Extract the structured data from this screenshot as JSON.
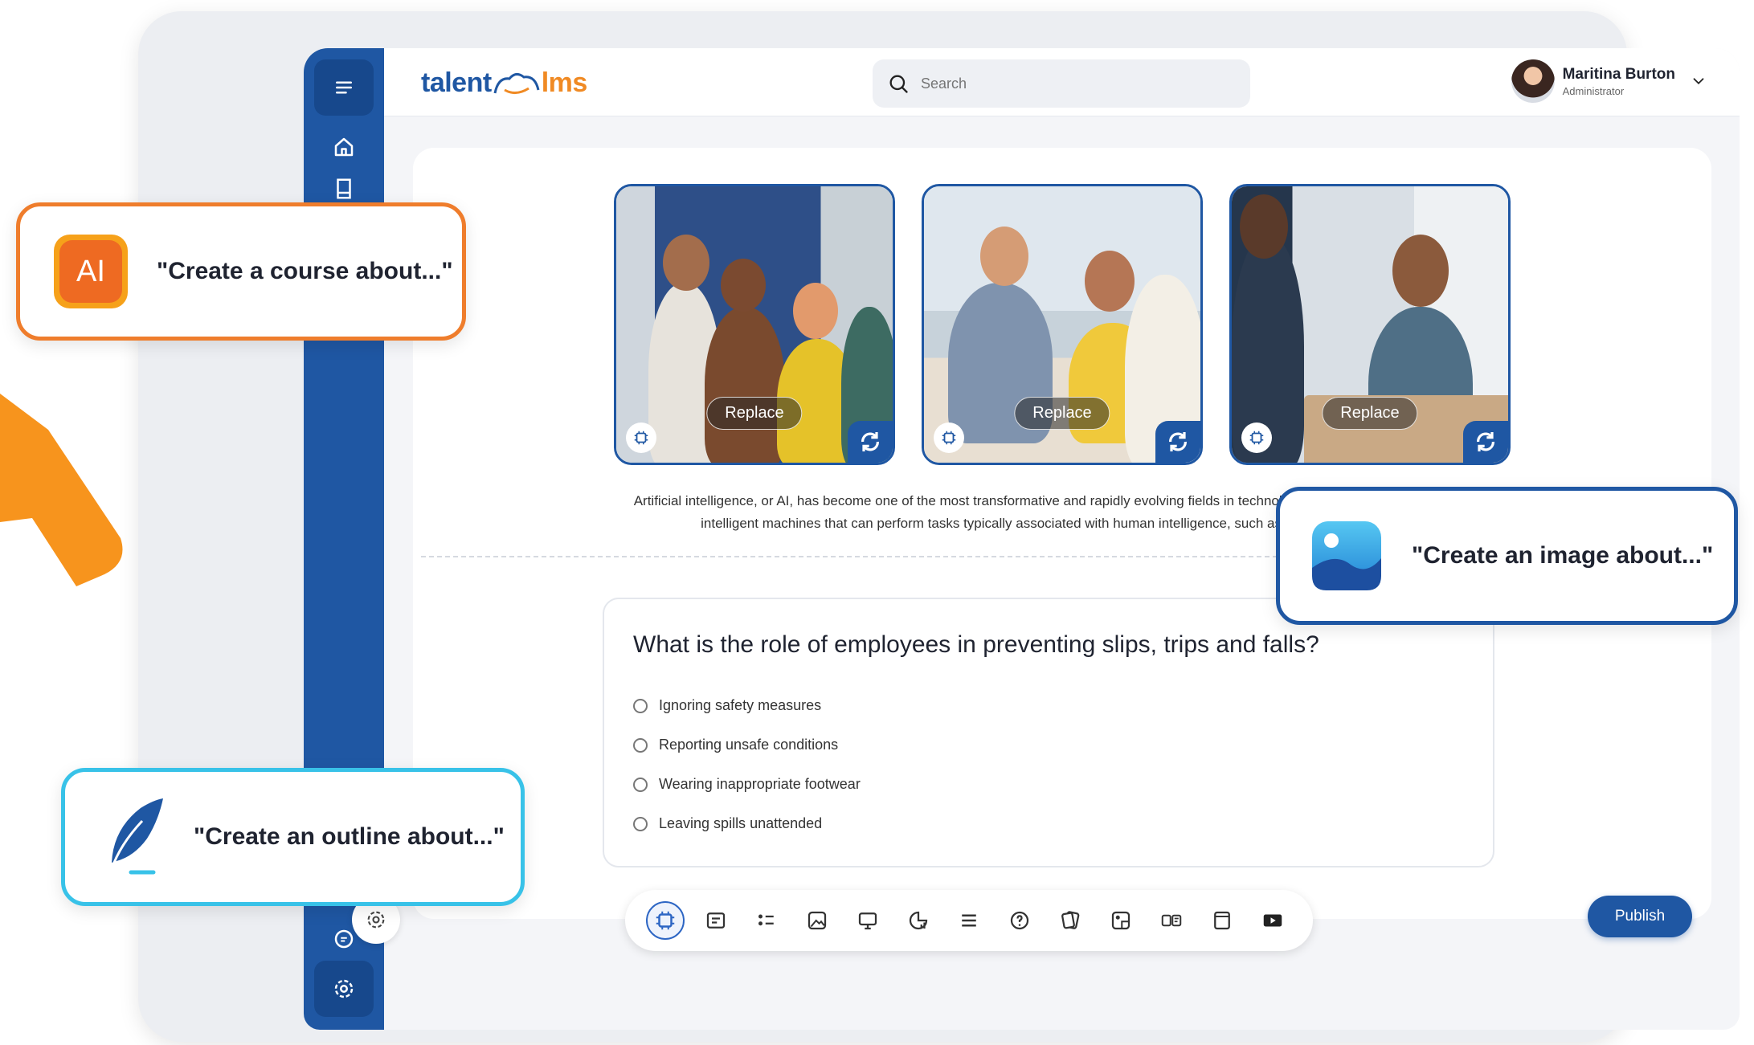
{
  "app": {
    "logo_left": "talent",
    "logo_right": "lms",
    "search_placeholder": "Search"
  },
  "user": {
    "name": "Maritina Burton",
    "role": "Administrator"
  },
  "sidebar": {
    "items": [
      "menu-icon",
      "home-icon",
      "book-icon",
      "chat-icon",
      "settings-icon"
    ]
  },
  "photos": [
    {
      "replace_label": "Replace"
    },
    {
      "replace_label": "Replace"
    },
    {
      "replace_label": "Replace"
    }
  ],
  "body_text": "Artificial intelligence, or AI, has become one of the most transformative and rapidly evolving fields in technology. It involves the creation of intelligent machines that can perform tasks typically associated with human intelligence, such as learning and probl",
  "quiz": {
    "question": "What is the role of employees in preventing slips, trips and falls?",
    "options": [
      "Ignoring safety measures",
      "Reporting unsafe conditions",
      "Wearing inappropriate footwear",
      "Leaving spills unattended"
    ]
  },
  "toolbar": {
    "tools": [
      "ai-chip-icon",
      "text-block-icon",
      "list-icon",
      "image-icon",
      "video-icon",
      "chart-icon",
      "lines-icon",
      "question-icon",
      "cards-icon",
      "gallery-icon",
      "toggle-icon",
      "page-icon",
      "embed-icon"
    ],
    "publish_label": "Publish"
  },
  "callouts": {
    "course": "\"Create a course about...\"",
    "image": "\"Create an image about...\"",
    "outline": "\"Create an outline about...\"",
    "ai_badge": "AI"
  },
  "colors": {
    "brand_blue": "#1f57a3",
    "brand_orange": "#ef7d2c",
    "accent_cyan": "#38c2e8"
  }
}
